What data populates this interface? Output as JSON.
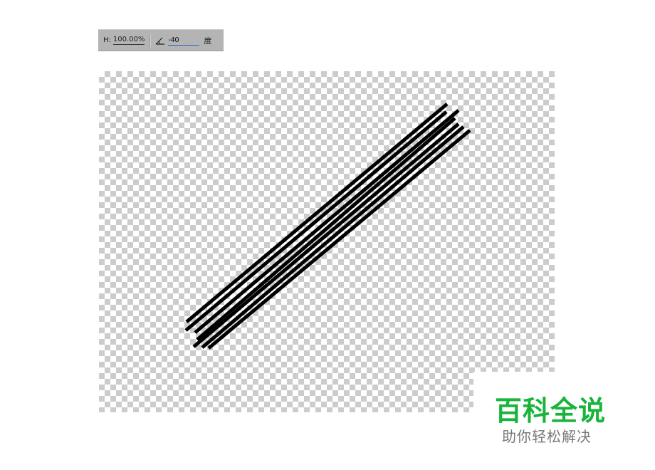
{
  "options_bar": {
    "height_label": "H:",
    "height_value": "100.00%",
    "angle_icon": "angle-icon",
    "angle_value": "-40",
    "angle_unit": "度"
  },
  "canvas": {
    "background": "transparency-checkerboard",
    "stroke_color": "#000000",
    "line_count": 7
  },
  "watermark": {
    "title": "百科全说",
    "subtitle": "助你轻松解决",
    "title_color": "#19b43c",
    "subtitle_color": "#777777"
  }
}
